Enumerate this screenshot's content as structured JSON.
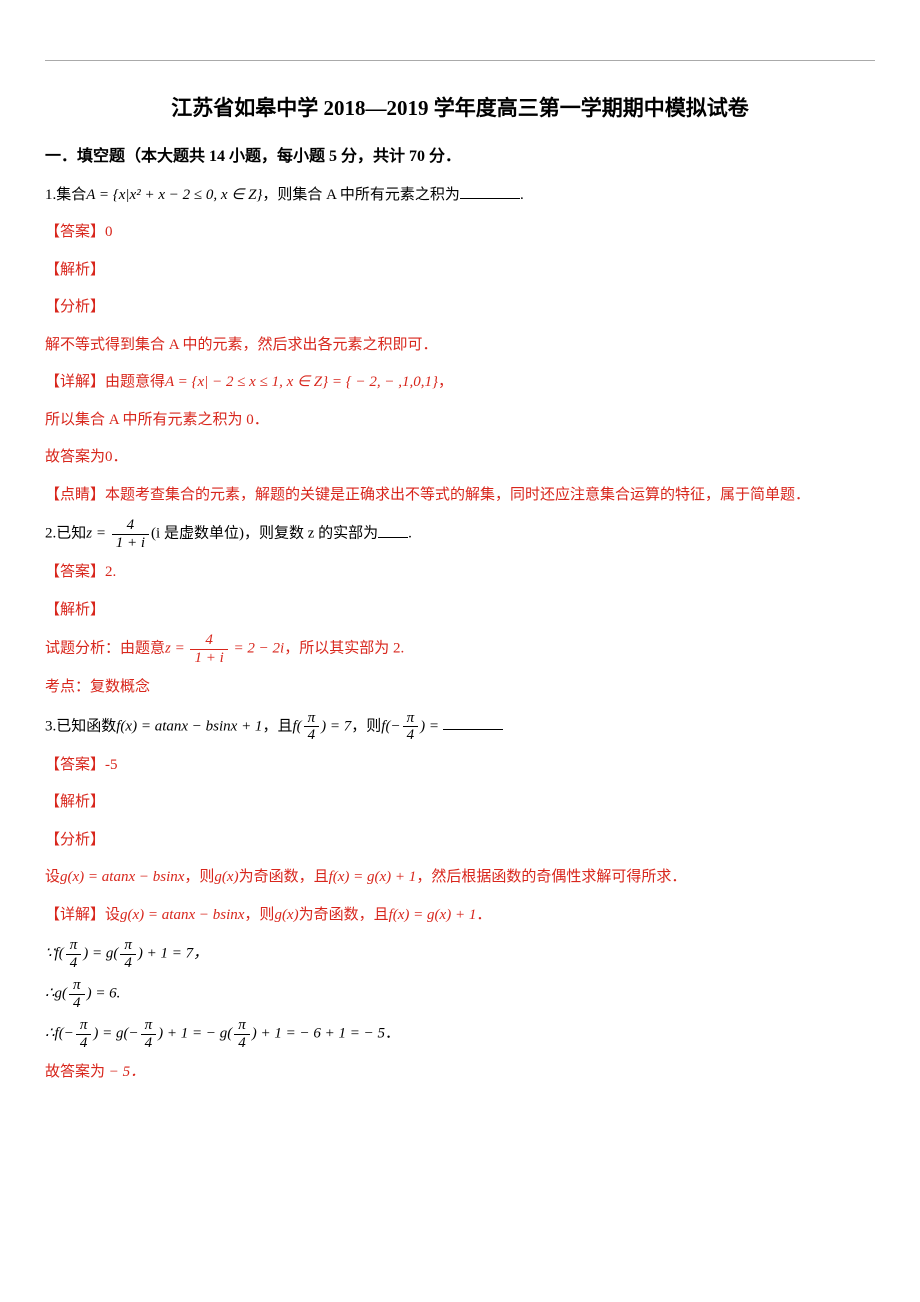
{
  "title": "江苏省如皋中学 2018—2019 学年度高三第一学期期中模拟试卷",
  "section_heading": "一．填空题（本大题共 14 小题，每小题 5 分，共计 70 分．",
  "labels": {
    "answer": "【答案】",
    "explain": "【解析】",
    "analyze": "【分析】",
    "detail": "【详解】",
    "comment": "【点睛】",
    "topic": "考点：",
    "final_prefix": "故答案为"
  },
  "q1": {
    "number": "1.",
    "text_a": "集合",
    "expr_A": "A = {x|x² + x − 2 ≤ 0, x ∈ Z}",
    "text_b": "，则集合 A 中所有元素之积为",
    "answer": "0",
    "analysis": "解不等式得到集合 A 中的元素，然后求出各元素之积即可．",
    "detail_a": "由题意得",
    "detail_expr": "A = {x| − 2 ≤ x ≤ 1, x ∈ Z} = { − 2, − ,1,0,1}",
    "detail_suffix": "，",
    "detail_b": "所以集合 A 中所有元素之积为 0．",
    "final": "0．",
    "comment": "本题考查集合的元素，解题的关键是正确求出不等式的解集，同时还应注意集合运算的特征，属于简单题．"
  },
  "q2": {
    "number": "2.",
    "text_a": "已知",
    "z_eq": "z =",
    "frac_num": "4",
    "frac_den": "1 + i",
    "text_b": "(i 是虚数单位)，则复数 z 的实部为",
    "answer": "2.",
    "analysis_a": "试题分析：由题意",
    "analysis_expr": "= 2 − 2i",
    "analysis_b": "，所以其实部为 2.",
    "topic": "复数概念"
  },
  "q3": {
    "number": "3.",
    "text_a": "已知函数",
    "fx": "f(x) = atanx − bsinx + 1",
    "text_b": "，且",
    "f_pi4": "f",
    "pi4_num": "π",
    "pi4_den": "4",
    "eq7": " = 7",
    "text_c": "，则",
    "f_neg_pi4": "f",
    "eq_blank": " =",
    "answer": "-5",
    "analysis_a": "设",
    "gx": "g(x) = atanx − bsinx",
    "analysis_b": "，则",
    "gx_odd": "g(x)",
    "analysis_c": "为奇函数，且",
    "fx_gx": "f(x) = g(x) + 1",
    "analysis_d": "，然后根据函数的奇偶性求解可得所求．",
    "detail_a": "设",
    "detail_b": "，则",
    "detail_c": "为奇函数，且",
    "detail_d": "．",
    "line1_a": "∵",
    "line1_b": " = g",
    "line1_c": " + 1 = 7，",
    "line2_a": "∴g",
    "line2_b": " = 6.",
    "line3_a": "∴f",
    "line3_b": " = g",
    "line3_c": " + 1 = − g",
    "line3_d": " + 1 = − 6 + 1 = − 5",
    "line3_e": "．",
    "final": " − 5．"
  }
}
